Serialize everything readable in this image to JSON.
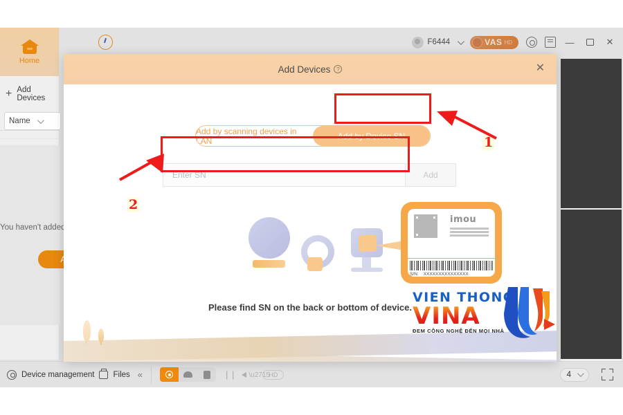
{
  "app": {
    "sidebar": {
      "home_label": "Home",
      "add_devices_label": "Add Devices",
      "sort_value": "Name",
      "empty_text": "You haven't added",
      "empty_button": "Add"
    },
    "toolbar": {
      "user_name": "F6444",
      "vas_label": "VAS",
      "vas_sub": "HD",
      "minimize": "—",
      "close": "✕"
    },
    "statusbar": {
      "device_management": "Device management",
      "files": "Files",
      "collapse": "«",
      "pause": "| |",
      "hd_label": "HD",
      "pane_count": "4"
    }
  },
  "dialog": {
    "title": "Add Devices",
    "help_glyph": "?",
    "close_glyph": "✕",
    "tabs": [
      {
        "label": "Add by scanning devices in LAN",
        "active": false
      },
      {
        "label": "Add by Device SN",
        "active": true
      }
    ],
    "sn_input_placeholder": "Enter SN",
    "sn_input_value": "",
    "add_button": "Add",
    "hint": "Please find SN on the back or bottom of device.",
    "label_card": {
      "brand": "imou",
      "sn_key": "S/N:",
      "sn_value": "XXXXXXXXXXXXXXX"
    }
  },
  "annotations": {
    "step1": "1",
    "step2": "2"
  },
  "watermark": {
    "line1": "VIEN THONG",
    "line2": "VINA",
    "tagline": "ĐEM CÔNG NGHỆ ĐẾN MỌI NHÀ"
  },
  "colors": {
    "accent_orange": "#e8880f",
    "dialog_header": "#f8d3a5",
    "tab_active": "#f8c286",
    "annotation_red": "#ef1b1b",
    "watermark_blue": "#1a5fc4",
    "watermark_red": "#e5231c"
  }
}
